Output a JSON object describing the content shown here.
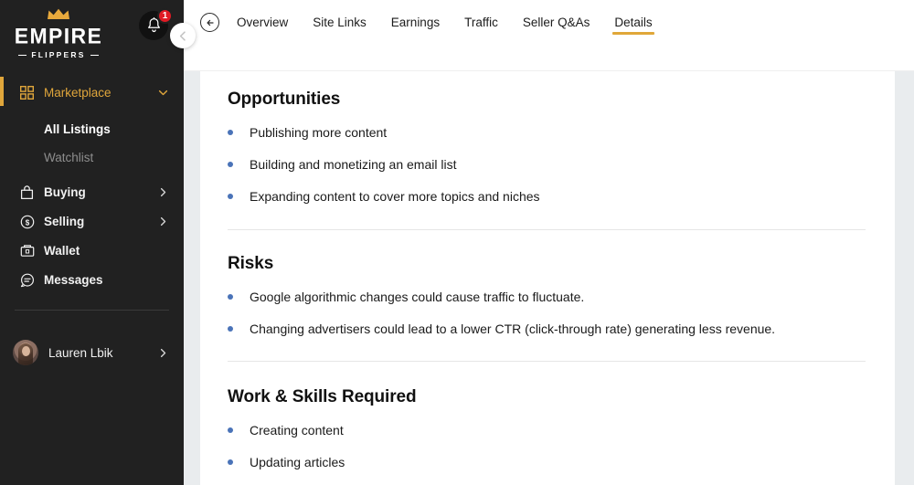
{
  "brand": {
    "logo_primary": "EMPIRE",
    "logo_secondary": "FLIPPERS",
    "accent_color": "#e0a739",
    "sidebar_color": "#212121",
    "bullet_color": "#4a73b8",
    "badge_color": "#e01b24"
  },
  "sidebar": {
    "notification_count": "1",
    "items": [
      {
        "label": "Marketplace",
        "icon": "grid-icon",
        "state": "active",
        "chevron": "chevron-down-icon"
      },
      {
        "label": "All Listings",
        "icon": "none",
        "state": "sub-active"
      },
      {
        "label": "Watchlist",
        "icon": "none",
        "state": "sub-muted"
      },
      {
        "label": "Buying",
        "icon": "bag-icon",
        "state": "default",
        "chevron": "chevron-right-icon"
      },
      {
        "label": "Selling",
        "icon": "dollar-circle-icon",
        "state": "default",
        "chevron": "chevron-right-icon"
      },
      {
        "label": "Wallet",
        "icon": "wallet-icon",
        "state": "default"
      },
      {
        "label": "Messages",
        "icon": "message-icon",
        "state": "default"
      }
    ],
    "profile": {
      "name": "Lauren Lbik",
      "chevron": "chevron-right-icon"
    }
  },
  "topbar": {
    "back_label": "back-arrow",
    "tabs": [
      {
        "label": "Overview",
        "active": false
      },
      {
        "label": "Site Links",
        "active": false
      },
      {
        "label": "Earnings",
        "active": false
      },
      {
        "label": "Traffic",
        "active": false
      },
      {
        "label": "Seller Q&As",
        "active": false
      },
      {
        "label": "Details",
        "active": true
      }
    ]
  },
  "main": {
    "sections": [
      {
        "title": "Opportunities",
        "bullets": [
          "Publishing more content",
          "Building and monetizing an email list",
          "Expanding content to cover more topics and niches"
        ]
      },
      {
        "title": "Risks",
        "bullets": [
          "Google algorithmic changes could cause traffic to fluctuate.",
          "Changing advertisers could lead to a lower CTR (click-through rate) generating less revenue."
        ]
      },
      {
        "title": "Work & Skills Required",
        "bullets": [
          "Creating content",
          "Updating articles"
        ]
      }
    ]
  }
}
